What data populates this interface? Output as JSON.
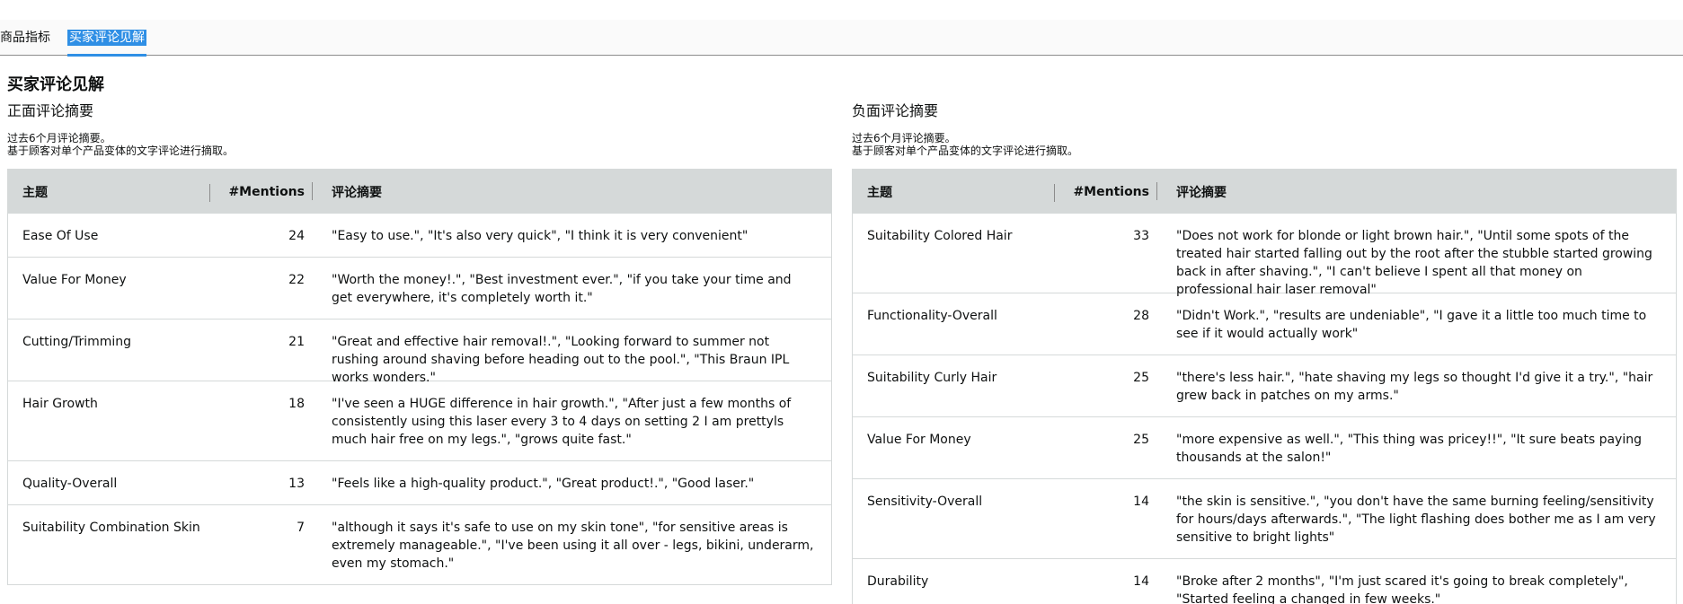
{
  "tabs": [
    {
      "label": "商品指标"
    },
    {
      "label": "买家评论见解"
    }
  ],
  "section_title": "买家评论见解",
  "positive": {
    "heading": "正面评论摘要",
    "note_line1": "过去6个月评论摘要。",
    "note_line2": "基于顾客对单个产品变体的文字评论进行摘取。",
    "columns": {
      "topic": "主题",
      "mentions": "#Mentions",
      "summary": "评论摘要"
    },
    "rows": [
      {
        "topic": "Ease Of Use",
        "mentions": "24",
        "summary": "\"Easy to use.\", \"It's also very quick\", \"I think it is very convenient\""
      },
      {
        "topic": "Value For Money",
        "mentions": "22",
        "summary": "\"Worth the money!.\", \"Best investment ever.\", \"if you take your time and get everywhere, it's completely worth it.\""
      },
      {
        "topic": "Cutting/Trimming",
        "mentions": "21",
        "summary": "\"Great and effective hair removal!.\", \"Looking forward to summer not rushing around shaving before heading out to the pool.\", \"This Braun IPL works wonders.\""
      },
      {
        "topic": "Hair Growth",
        "mentions": "18",
        "summary": "\"I've seen a HUGE difference in hair growth.\", \"After just a few months of consistently using this laser every 3 to 4 days on setting 2 I am prettyls much hair free on my legs.\", \"grows quite fast.\""
      },
      {
        "topic": "Quality-Overall",
        "mentions": "13",
        "summary": "\"Feels like a high-quality product.\", \"Great product!.\", \"Good laser.\""
      },
      {
        "topic": "Suitability Combination Skin",
        "mentions": "7",
        "summary": "\"although it says it's safe to use on my skin tone\", \"for sensitive areas is extremely manageable.\", \"I've been using it all over - legs, bikini, underarm, even my stomach.\""
      }
    ]
  },
  "negative": {
    "heading": "负面评论摘要",
    "note_line1": "过去6个月评论摘要。",
    "note_line2": "基于顾客对单个产品变体的文字评论进行摘取。",
    "columns": {
      "topic": "主题",
      "mentions": "#Mentions",
      "summary": "评论摘要"
    },
    "rows": [
      {
        "topic": "Suitability Colored Hair",
        "mentions": "33",
        "summary": "\"Does not work for blonde or light brown hair.\", \"Until some spots of the treated hair started falling out by the root after the stubble started growing back in after shaving.\", \"I can't believe I spent all that money on professional hair laser removal\""
      },
      {
        "topic": "Functionality-Overall",
        "mentions": "28",
        "summary": "\"Didn't Work.\", \"results are undeniable\", \"I gave it a little too much time to see if it would actually work\""
      },
      {
        "topic": "Suitability Curly Hair",
        "mentions": "25",
        "summary": "\"there's less hair.\", \"hate shaving my legs so thought I'd give it a try.\", \"hair grew back in patches on my arms.\""
      },
      {
        "topic": "Value For Money",
        "mentions": "25",
        "summary": "\"more expensive as well.\", \"This thing was pricey!!\", \"It sure beats paying thousands at the salon!\""
      },
      {
        "topic": "Sensitivity-Overall",
        "mentions": "14",
        "summary": "\"the skin is sensitive.\", \"you don't have the same burning feeling/sensitivity for hours/days afterwards.\", \"The light flashing does bother me as I am very sensitive to bright lights\""
      },
      {
        "topic": "Durability",
        "mentions": "14",
        "summary": "\"Broke after 2 months\", \"I'm just scared it's going to break completely\", \"Started feeling a changed in few weeks.\""
      }
    ]
  }
}
